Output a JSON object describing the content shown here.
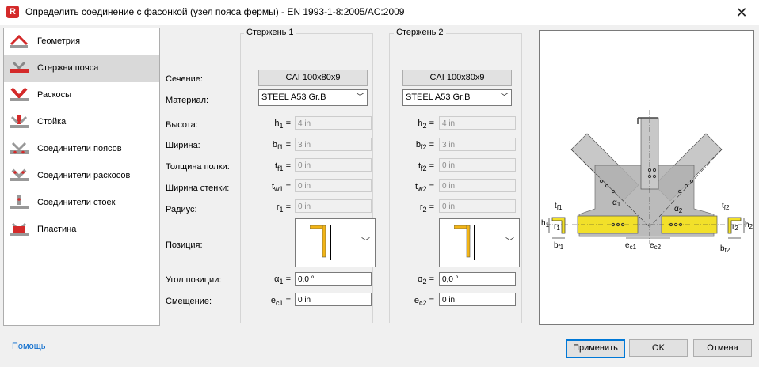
{
  "window": {
    "title": "Определить соединение с фасонкой (узел пояса фермы) - EN 1993-1-8:2005/AC:2009",
    "app_icon": "R"
  },
  "sidebar": {
    "items": [
      {
        "label": "Геометрия",
        "icon": "geometry-icon"
      },
      {
        "label": "Стержни пояса",
        "icon": "chord-bars-icon"
      },
      {
        "label": "Раскосы",
        "icon": "diagonals-icon"
      },
      {
        "label": "Стойка",
        "icon": "post-icon"
      },
      {
        "label": "Соединители поясов",
        "icon": "chord-connectors-icon"
      },
      {
        "label": "Соединители раскосов",
        "icon": "diagonal-connectors-icon"
      },
      {
        "label": "Соединители стоек",
        "icon": "post-connectors-icon"
      },
      {
        "label": "Пластина",
        "icon": "plate-icon"
      }
    ],
    "selected": 1
  },
  "labels": {
    "section": "Сечение:",
    "material": "Материал:",
    "height": "Высота:",
    "width": "Ширина:",
    "flange_thickness": "Толщина полки:",
    "web_thickness": "Ширина стенки:",
    "radius": "Радиус:",
    "position": "Позиция:",
    "position_angle": "Угол позиции:",
    "offset": "Смещение:"
  },
  "bar1": {
    "title": "Стержень 1",
    "section": "CAI 100x80x9",
    "material": "STEEL A53 Gr.B",
    "h": {
      "sym": "h",
      "sub": "1",
      "val": "4 in"
    },
    "b": {
      "sym": "b",
      "sub": "f1",
      "val": "3 in"
    },
    "tf": {
      "sym": "t",
      "sub": "f1",
      "val": "0 in"
    },
    "tw": {
      "sym": "t",
      "sub": "w1",
      "val": "0 in"
    },
    "r": {
      "sym": "r",
      "sub": "1",
      "val": "0 in"
    },
    "alpha": {
      "sym": "α",
      "sub": "1",
      "val": "0,0 °"
    },
    "e": {
      "sym": "e",
      "sub": "c1",
      "val": "0 in"
    }
  },
  "bar2": {
    "title": "Стержень 2",
    "section": "CAI 100x80x9",
    "material": "STEEL A53 Gr.B",
    "h": {
      "sym": "h",
      "sub": "2",
      "val": "4 in"
    },
    "b": {
      "sym": "b",
      "sub": "f2",
      "val": "3 in"
    },
    "tf": {
      "sym": "t",
      "sub": "f2",
      "val": "0 in"
    },
    "tw": {
      "sym": "t",
      "sub": "w2",
      "val": "0 in"
    },
    "r": {
      "sym": "r",
      "sub": "2",
      "val": "0 in"
    },
    "alpha": {
      "sym": "α",
      "sub": "2",
      "val": "0,0 °"
    },
    "e": {
      "sym": "e",
      "sub": "c2",
      "val": "0 in"
    }
  },
  "preview": {
    "labels": {
      "tf1": "t",
      "tf1s": "f1",
      "h1": "h",
      "h1s": "1",
      "r1": "r",
      "r1s": "1",
      "bf1": "b",
      "bf1s": "f1",
      "ec1": "e",
      "ec1s": "c1",
      "ec2": "e",
      "ec2s": "c2",
      "a1": "α",
      "a1s": "1",
      "a2": "α",
      "a2s": "2",
      "tf2": "t",
      "tf2s": "f2",
      "r2": "r",
      "r2s": "2",
      "h2": "h",
      "h2s": "2",
      "bf2": "b",
      "bf2s": "f2"
    },
    "colors": {
      "chord": "#f2e02a",
      "gusset": "#b0b0b0",
      "member": "#c8c8c8"
    }
  },
  "footer": {
    "help": "Помощь",
    "apply": "Применить",
    "ok": "OK",
    "cancel": "Отмена"
  },
  "colors": {
    "accent": "#0078d7",
    "icon_red": "#d42a2a"
  }
}
